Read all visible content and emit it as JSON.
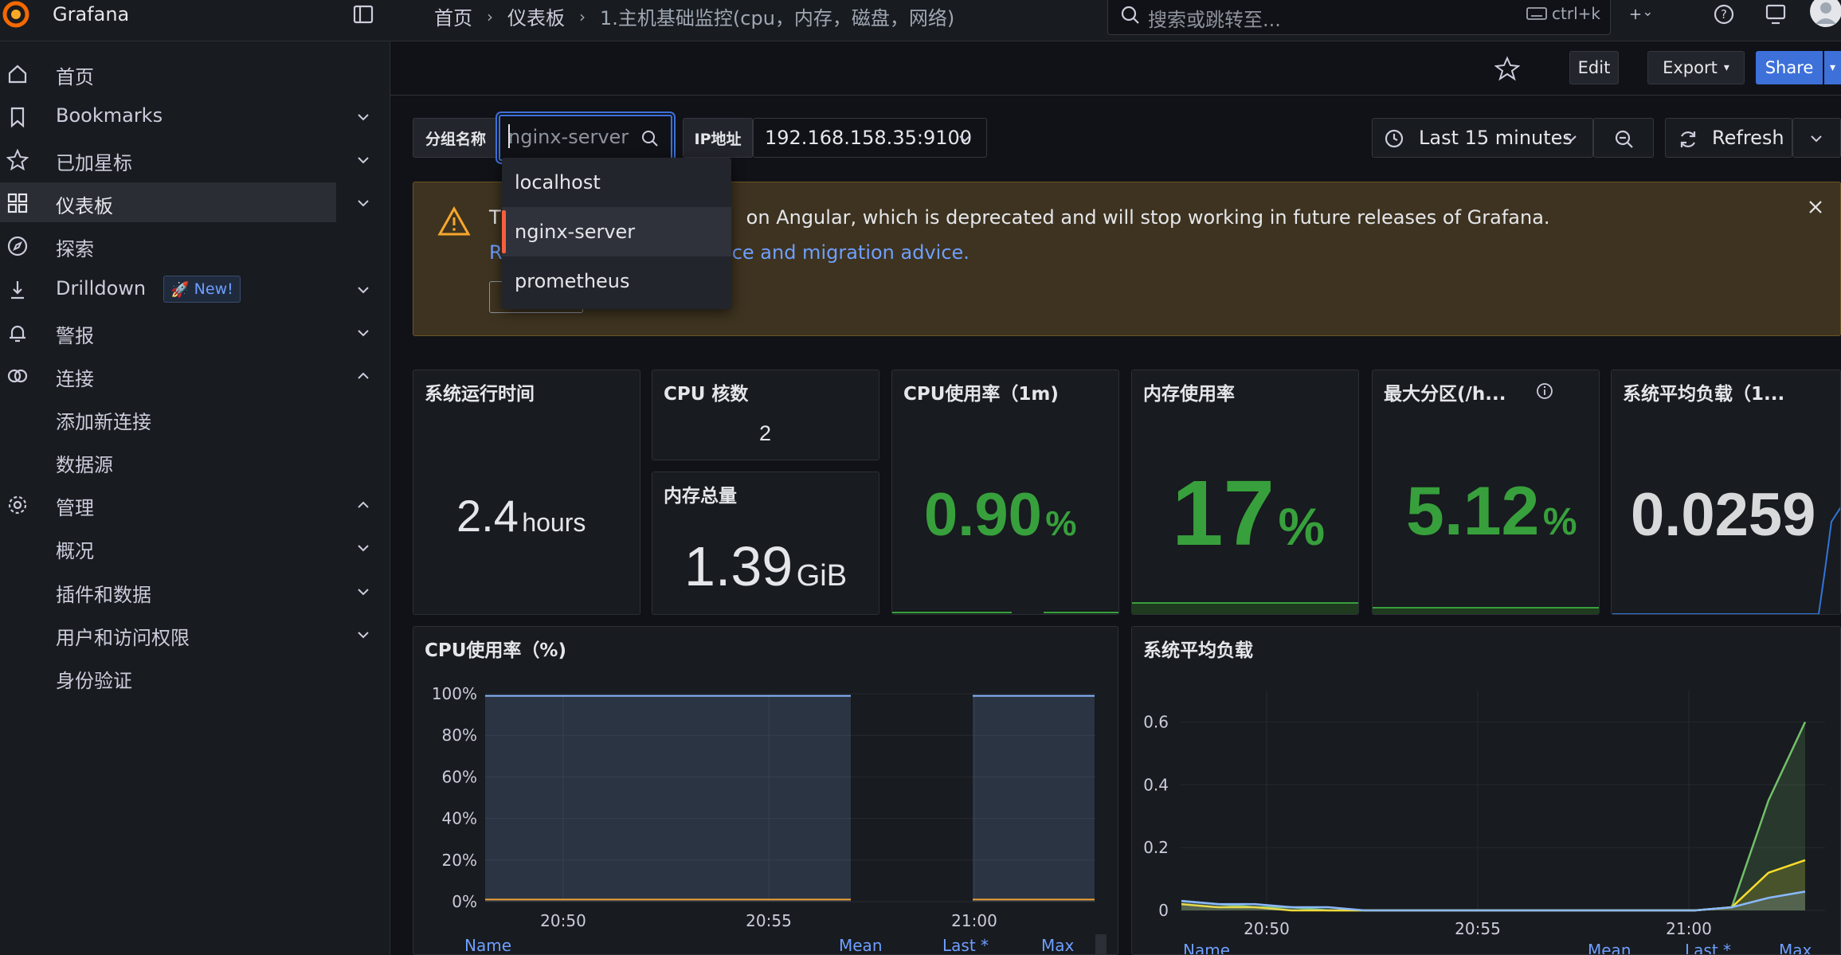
{
  "app": {
    "name": "Grafana"
  },
  "breadcrumb": {
    "home": "首页",
    "dashboards": "仪表板",
    "current": "1.主机基础监控(cpu，内存，磁盘，网络)"
  },
  "search": {
    "placeholder": "搜索或跳转至...",
    "shortcut": "ctrl+k"
  },
  "toolbar": {
    "edit": "Edit",
    "export": "Export",
    "share": "Share"
  },
  "sidebar": {
    "items": [
      {
        "label": "首页"
      },
      {
        "label": "Bookmarks"
      },
      {
        "label": "已加星标"
      },
      {
        "label": "仪表板"
      },
      {
        "label": "探索"
      },
      {
        "label": "Drilldown"
      },
      {
        "label": "警报"
      },
      {
        "label": "连接"
      },
      {
        "label": "添加新连接"
      },
      {
        "label": "数据源"
      },
      {
        "label": "管理"
      },
      {
        "label": "概况"
      },
      {
        "label": "插件和数据"
      },
      {
        "label": "用户和访问权限"
      },
      {
        "label": "身份验证"
      }
    ],
    "new_badge": "New!"
  },
  "variables": {
    "group_label": "分组名称",
    "group_input": "nginx-server",
    "ip_label": "IP地址",
    "ip_value": "192.168.158.35:9100"
  },
  "dropdown": {
    "options": [
      "localhost",
      "nginx-server",
      "prometheus"
    ],
    "selected": "nginx-server"
  },
  "time": {
    "range": "Last 15 minutes",
    "refresh": "Refresh"
  },
  "alert": {
    "text_start": "T",
    "text_visible": "on Angular, which is deprecated and will stop working in future releases of Grafana.",
    "link_start": "R",
    "link_visible": "ce and migration advice."
  },
  "panels": {
    "uptime": {
      "title": "系统运行时间",
      "value": "2.4",
      "unit": "hours"
    },
    "cpu_cores": {
      "title": "CPU 核数",
      "value": "2"
    },
    "mem_total": {
      "title": "内存总量",
      "value": "1.39",
      "unit": "GiB"
    },
    "cpu_usage": {
      "title": "CPU使用率（1m)",
      "value": "0.90",
      "unit": "%"
    },
    "mem_usage": {
      "title": "内存使用率",
      "value": "17",
      "unit": "%"
    },
    "max_part": {
      "title": "最大分区(/h...",
      "value": "5.12",
      "unit": "%"
    },
    "load": {
      "title": "系统平均负载（1...",
      "value": "0.0259"
    }
  },
  "cpu_chart": {
    "title": "CPU使用率（%)",
    "legend": {
      "name": "Name",
      "mean": "Mean",
      "last": "Last *",
      "max": "Max"
    }
  },
  "load_chart": {
    "title": "系统平均负载",
    "legend": {
      "name": "Name",
      "mean": "Mean",
      "last": "Last *",
      "max": "Max"
    }
  },
  "chart_data": [
    {
      "type": "area",
      "title": "CPU使用率（%)",
      "x": [
        "20:50",
        "20:55",
        "21:00"
      ],
      "ylim": [
        0,
        100
      ],
      "yticks": [
        "100%",
        "80%",
        "60%",
        "40%",
        "20%",
        "0%"
      ],
      "series": [
        {
          "values": [
            99,
            99,
            99,
            99,
            99,
            99,
            99,
            99,
            99,
            99,
            99
          ],
          "color": "#8ab8ff"
        },
        {
          "values": [
            1,
            1,
            1,
            1,
            1,
            1,
            1,
            1,
            1,
            1,
            1
          ],
          "color": "#f2a233"
        }
      ],
      "segments": [
        [
          0,
          6
        ],
        [
          8,
          10
        ]
      ]
    },
    {
      "type": "line",
      "title": "系统平均负载",
      "x": [
        "20:50",
        "20:55",
        "21:00"
      ],
      "ylim": [
        0,
        0.7
      ],
      "yticks": [
        "0.6",
        "0.4",
        "0.2",
        "0"
      ],
      "series": [
        {
          "values": [
            0.03,
            0.02,
            0.01,
            0.01,
            0,
            0,
            0,
            0,
            0,
            0,
            0,
            0,
            0,
            0,
            0,
            0.01,
            0.35,
            0.6
          ],
          "color": "#73bf69"
        },
        {
          "values": [
            0.02,
            0.01,
            0.01,
            0,
            0,
            0,
            0,
            0,
            0,
            0,
            0,
            0,
            0,
            0,
            0,
            0.01,
            0.12,
            0.16
          ],
          "color": "#fade2a"
        },
        {
          "values": [
            0.03,
            0.02,
            0.02,
            0.01,
            0.01,
            0,
            0,
            0,
            0,
            0,
            0,
            0,
            0,
            0,
            0,
            0.01,
            0.04,
            0.06
          ],
          "color": "#8ab8ff"
        }
      ]
    }
  ]
}
